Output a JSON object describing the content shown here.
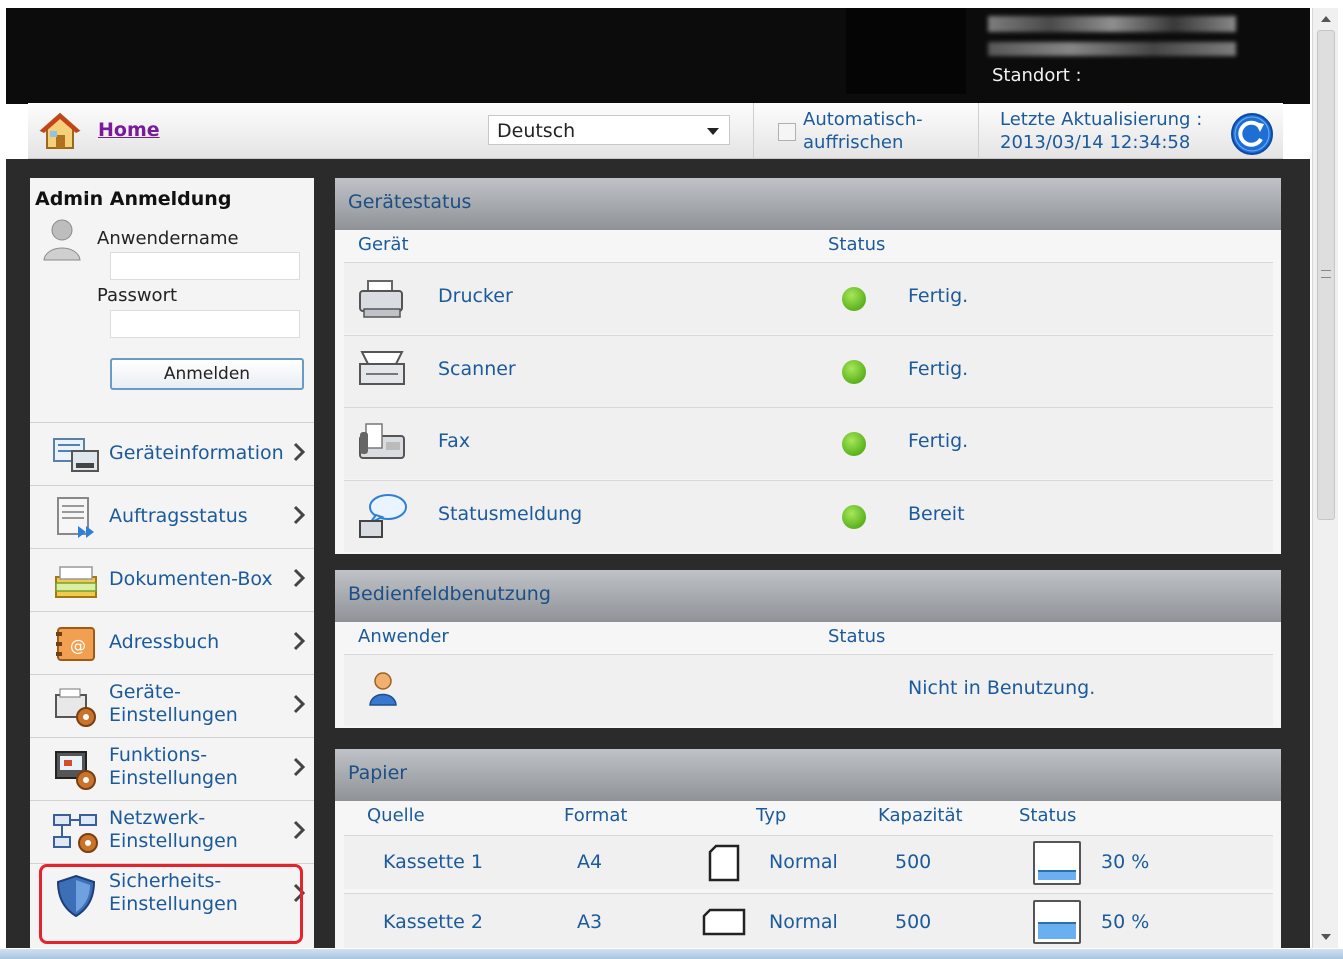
{
  "header": {
    "standort_label": "Standort :"
  },
  "nav": {
    "home_label": "Home",
    "language_selected": "Deutsch",
    "auto_refresh_label_line1": "Automatisch-",
    "auto_refresh_label_line2": "auffrischen",
    "last_update_label": "Letzte Aktualisierung :",
    "last_update_value": "2013/03/14 12:34:58"
  },
  "sidebar": {
    "login_title": "Admin Anmeldung",
    "username_label": "Anwendername",
    "password_label": "Passwort",
    "login_button": "Anmelden",
    "items": [
      {
        "line1": "Geräteinformation",
        "line2": ""
      },
      {
        "line1": "Auftragsstatus",
        "line2": ""
      },
      {
        "line1": "Dokumenten-Box",
        "line2": ""
      },
      {
        "line1": "Adressbuch",
        "line2": ""
      },
      {
        "line1": "Geräte-",
        "line2": "Einstellungen"
      },
      {
        "line1": "Funktions-",
        "line2": "Einstellungen"
      },
      {
        "line1": "Netzwerk-",
        "line2": "Einstellungen"
      },
      {
        "line1": "Sicherheits-",
        "line2": "Einstellungen"
      }
    ]
  },
  "device_status": {
    "title": "Gerätestatus",
    "col_device": "Gerät",
    "col_status": "Status",
    "rows": [
      {
        "device": "Drucker",
        "status": "Fertig.",
        "icon": "printer-icon"
      },
      {
        "device": "Scanner",
        "status": "Fertig.",
        "icon": "scanner-icon"
      },
      {
        "device": "Fax",
        "status": "Fertig.",
        "icon": "fax-icon"
      },
      {
        "device": "Statusmeldung",
        "status": "Bereit",
        "icon": "status-message-icon"
      }
    ]
  },
  "panel_usage": {
    "title": "Bedienfeldbenutzung",
    "col_user": "Anwender",
    "col_status": "Status",
    "row_status": "Nicht in Benutzung."
  },
  "paper": {
    "title": "Papier",
    "col_source": "Quelle",
    "col_format": "Format",
    "col_type": "Typ",
    "col_capacity": "Kapazität",
    "col_status": "Status",
    "rows": [
      {
        "source": "Kassette 1",
        "format": "A4",
        "type": "Normal",
        "capacity": "500",
        "level": "30 %",
        "fill_fraction": 0.3
      },
      {
        "source": "Kassette 2",
        "format": "A3",
        "type": "Normal",
        "capacity": "500",
        "level": "50 %",
        "fill_fraction": 0.5
      }
    ]
  },
  "colors": {
    "link_blue": "#1c5a9c",
    "status_green": "#5cb21d",
    "highlight_red": "#e4232c"
  }
}
